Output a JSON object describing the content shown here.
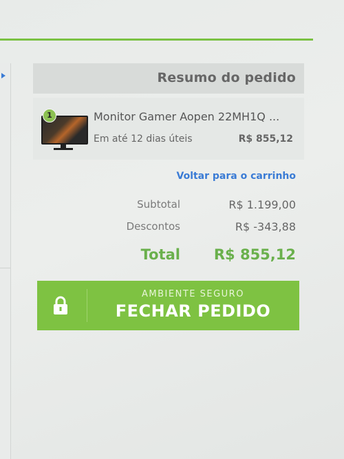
{
  "summary": {
    "title": "Resumo do pedido"
  },
  "product": {
    "quantity": "1",
    "name": "Monitor Gamer Aopen 22MH1Q ...",
    "delivery": "Em até 12 dias úteis",
    "price": "R$ 855,12",
    "image_icon": "monitor-image"
  },
  "back_link": "Voltar para o carrinho",
  "totals": {
    "subtotal_label": "Subtotal",
    "subtotal_value": "R$ 1.199,00",
    "discount_label": "Descontos",
    "discount_value": "R$ -343,88",
    "total_label": "Total",
    "total_value": "R$ 855,12"
  },
  "checkout_button": {
    "small_label": "AMBIENTE SEGURO",
    "main_label": "FECHAR PEDIDO",
    "icon": "lock-icon"
  },
  "colors": {
    "accent_green": "#7ec242",
    "total_green": "#6ab04c",
    "link_blue": "#3a7bd5"
  }
}
